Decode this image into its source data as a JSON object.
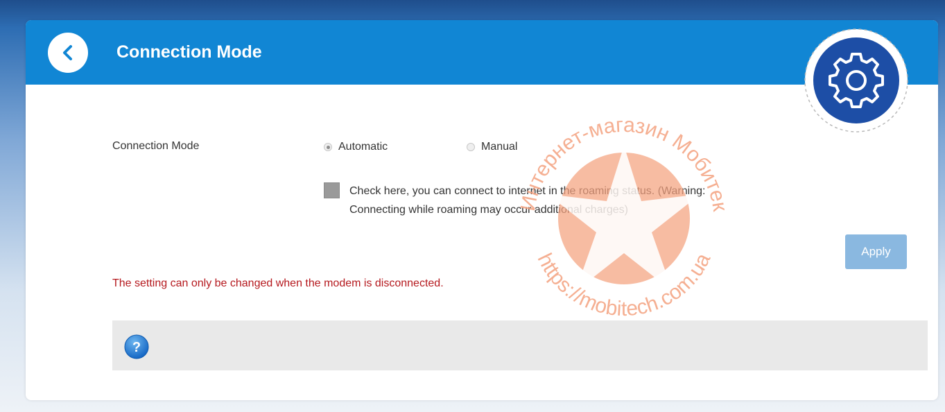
{
  "header": {
    "title": "Connection Mode",
    "back_icon": "chevron-left-icon",
    "settings_icon": "gear-icon"
  },
  "form": {
    "connection_mode_label": "Connection Mode",
    "options": [
      {
        "label": "Automatic",
        "selected": true
      },
      {
        "label": "Manual",
        "selected": false
      }
    ],
    "roaming_checked": false,
    "roaming_line1": "Check here, you can connect to internet in the roaming status. (Warning:",
    "roaming_line2": "Connecting while roaming may occur additional charges)",
    "apply_label": "Apply",
    "warning": "The setting can only be changed when the modem is disconnected."
  },
  "help": {
    "icon": "help-icon"
  },
  "watermark": {
    "arc_top": "Интернет-магазин Мобитек",
    "arc_bottom": "https://mobitech.com.ua"
  },
  "colors": {
    "header_bg": "#1186d4",
    "apply_bg": "#8ab8e0",
    "warning_text": "#b5191e",
    "gear_badge": "#1d4ea6",
    "watermark": "#f4a27f"
  }
}
